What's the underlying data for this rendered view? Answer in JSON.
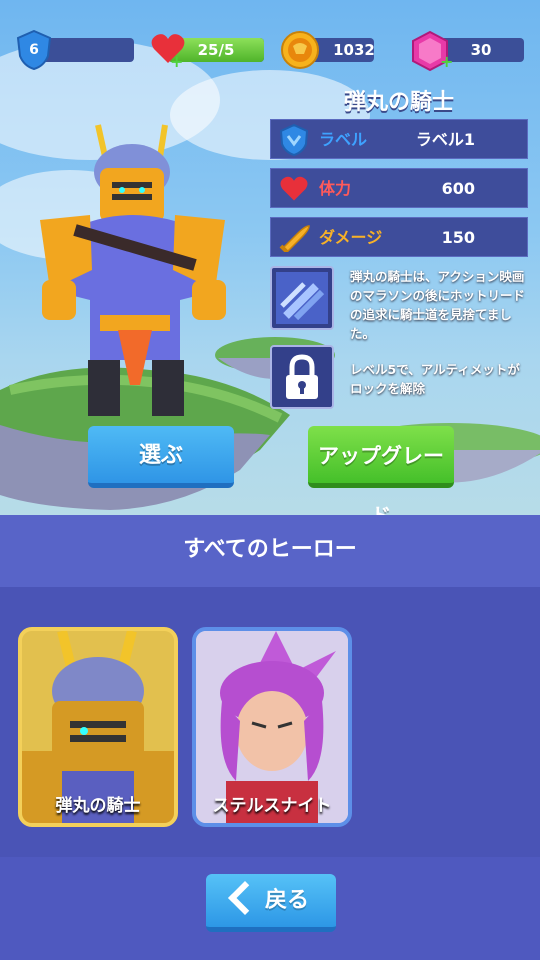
{
  "top_bar": {
    "level": "6",
    "health": {
      "text": "25/5",
      "fill": 1.0
    },
    "coins": "1032",
    "gems": "30"
  },
  "hero": {
    "name": "弾丸の騎士",
    "stats": [
      {
        "label": "ラベル",
        "value": "ラベル1",
        "label_color": "#3ea2ff",
        "icon": "shield-icon"
      },
      {
        "label": "体力",
        "value": "600",
        "label_color": "#ff5a5a",
        "icon": "heart-icon"
      },
      {
        "label": "ダメージ",
        "value": "150",
        "label_color": "#f7b128",
        "icon": "bullet-icon"
      }
    ],
    "skills": [
      {
        "icon": "bullets-skill-icon",
        "text": "弾丸の騎士は、アクション映画のマラソンの後にホットリードの追求に騎士道を見捨てました。"
      },
      {
        "icon": "lock-icon",
        "text": "レベル5で、アルティメットがロックを解除"
      }
    ]
  },
  "buttons": {
    "select": "選ぶ",
    "upgrade": "アップグレード",
    "back": "戻る"
  },
  "all_heroes": {
    "title": "すべてのヒーロー",
    "cards": [
      {
        "name": "弾丸の騎士",
        "selected": true
      },
      {
        "name": "ステルスナイト",
        "selected": false
      }
    ]
  },
  "colors": {
    "select_button": "#3aa8f0",
    "upgrade_button": "#5fcf35",
    "back_button": "#3aa8f0",
    "panel": "#4f59bf"
  }
}
